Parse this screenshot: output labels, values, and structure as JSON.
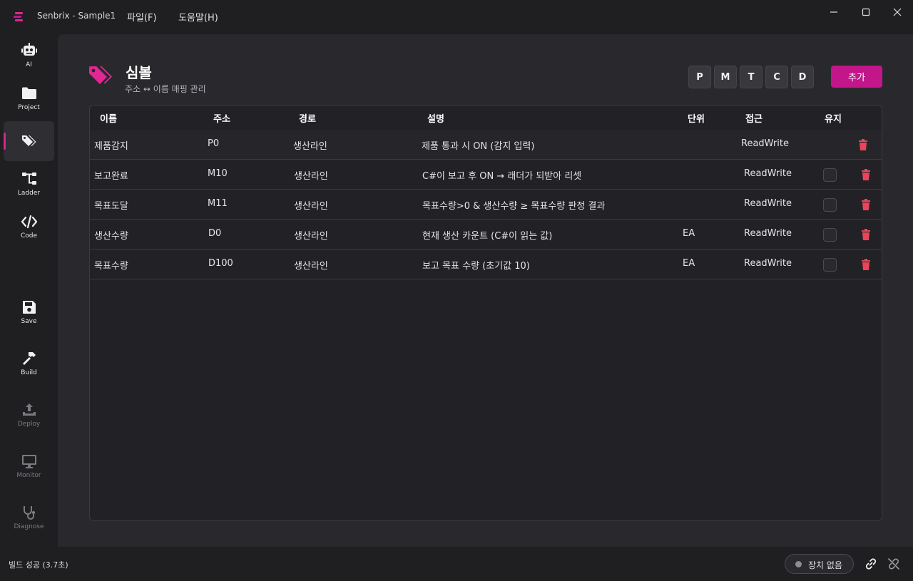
{
  "titlebar": {
    "app_title": "Senbrix - Sample1",
    "menus": [
      {
        "label": "파일(F)"
      },
      {
        "label": "도움말(H)"
      }
    ]
  },
  "sidebar": {
    "items": [
      {
        "label": "AI",
        "icon": "robot-icon"
      },
      {
        "label": "Project",
        "icon": "folder-icon"
      },
      {
        "label": "",
        "icon": "tag-icon",
        "active": true
      },
      {
        "label": "Ladder",
        "icon": "ladder-diagram-icon"
      },
      {
        "label": "Code",
        "icon": "code-icon"
      },
      {
        "label": "Save",
        "icon": "save-icon"
      },
      {
        "label": "Build",
        "icon": "hammer-icon"
      },
      {
        "label": "Deploy",
        "icon": "upload-icon",
        "disabled": true
      },
      {
        "label": "Monitor",
        "icon": "monitor-icon",
        "disabled": true
      },
      {
        "label": "Diagnose",
        "icon": "stethoscope-icon",
        "disabled": true
      }
    ]
  },
  "page": {
    "title": "심볼",
    "subtitle": "주소 ↔ 이름 매핑 관리",
    "filters": [
      "P",
      "M",
      "T",
      "C",
      "D"
    ],
    "add_label": "추가"
  },
  "table": {
    "columns": [
      "이름",
      "주소",
      "경로",
      "설명",
      "단위",
      "접근",
      "유지"
    ],
    "rows": [
      {
        "name": "제품감지",
        "address": "P0",
        "path": "생산라인",
        "description": "제품 통과 시 ON (감지 입력)",
        "unit": "",
        "access": "ReadWrite",
        "retain": null
      },
      {
        "name": "보고완료",
        "address": "M10",
        "path": "생산라인",
        "description": "C#이 보고 후 ON → 래더가 되받아 리셋",
        "unit": "",
        "access": "ReadWrite",
        "retain": false
      },
      {
        "name": "목표도달",
        "address": "M11",
        "path": "생산라인",
        "description": "목표수량>0 & 생산수량 ≥ 목표수량 판정 결과",
        "unit": "",
        "access": "ReadWrite",
        "retain": false
      },
      {
        "name": "생산수량",
        "address": "D0",
        "path": "생산라인",
        "description": "현재 생산 카운트 (C#이 읽는 값)",
        "unit": "EA",
        "access": "ReadWrite",
        "retain": false
      },
      {
        "name": "목표수량",
        "address": "D100",
        "path": "생산라인",
        "description": "보고 목표 수량 (초기값 10)",
        "unit": "EA",
        "access": "ReadWrite",
        "retain": false
      }
    ]
  },
  "statusbar": {
    "build_status": "빌드 성공 (3.7초)",
    "device_label": "장치 없음"
  },
  "colors": {
    "accent": "#c3168a",
    "delete": "#e8455a"
  }
}
